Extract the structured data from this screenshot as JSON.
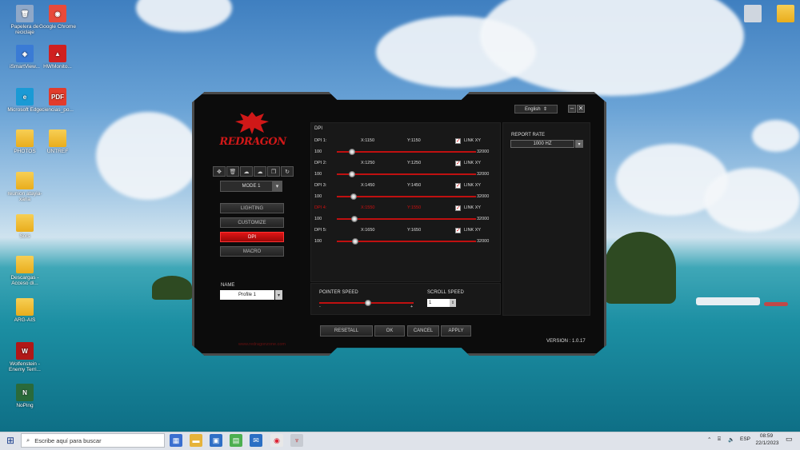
{
  "desktop": {
    "icons": [
      {
        "label": "Papelera de reciclaje",
        "glyph": "🗑",
        "color": "#8fa8c8"
      },
      {
        "label": "Google Chrome",
        "glyph": "◉",
        "color": "#e84a3a"
      },
      {
        "label": "iSmartView...",
        "glyph": "◈",
        "color": "#3a7bd5"
      },
      {
        "label": "HWMonito...",
        "glyph": "▲",
        "color": "#d02020"
      },
      {
        "label": "Microsoft Edge",
        "glyph": "e",
        "color": "#1a9ad5"
      },
      {
        "label": "ciencias_po...",
        "glyph": "PDF",
        "color": "#e23c2c"
      },
      {
        "label": "PHOTOS",
        "glyph": "",
        "color": "folder"
      },
      {
        "label": "UNTREF",
        "glyph": "",
        "color": "folder"
      },
      {
        "label": "reunion atayia-xana",
        "glyph": "",
        "color": "folder"
      },
      {
        "label": "Sors",
        "glyph": "",
        "color": "folder"
      },
      {
        "label": "Descargas - Acceso di...",
        "glyph": "",
        "color": "folder"
      },
      {
        "label": "ARG-AIS",
        "glyph": "",
        "color": "folder"
      },
      {
        "label": "Wolfenstein - Enemy Terri...",
        "glyph": "W",
        "color": "#b01818"
      },
      {
        "label": "NoPing",
        "glyph": "N",
        "color": "#2a6a3a"
      },
      {
        "label": "",
        "glyph": "",
        "color": "#cfd6df"
      },
      {
        "label": "",
        "glyph": "",
        "color": "folder"
      }
    ]
  },
  "app": {
    "brand": "REDRAGON",
    "language": "English",
    "mode": "MODE 1",
    "nav": [
      "LIGHTING",
      "CUSTOMIZE",
      "DPI",
      "MACRO"
    ],
    "active_nav": "DPI",
    "name_label": "NAME",
    "profile": "Profile 1",
    "url": "www.redragonzone.com",
    "dpi_title": "DPI",
    "dpi_rows": [
      {
        "label": "DPI 1:",
        "x": "X:1150",
        "y": "Y:1150",
        "link": "LINK XY",
        "min": "100",
        "max": "32000",
        "value": 1150,
        "active": false
      },
      {
        "label": "DPI 2:",
        "x": "X:1250",
        "y": "Y:1250",
        "link": "LINK XY",
        "min": "100",
        "max": "32000",
        "value": 1250,
        "active": false
      },
      {
        "label": "DPI 3:",
        "x": "X:1450",
        "y": "Y:1450",
        "link": "LINK XY",
        "min": "100",
        "max": "32000",
        "value": 1450,
        "active": false
      },
      {
        "label": "DPI 4:",
        "x": "X:1550",
        "y": "Y:1550",
        "link": "LINK XY",
        "min": "100",
        "max": "32000",
        "value": 1550,
        "active": true
      },
      {
        "label": "DPI 5:",
        "x": "X:1650",
        "y": "Y:1650",
        "link": "LINK XY",
        "min": "100",
        "max": "32000",
        "value": 1650,
        "active": false
      }
    ],
    "report_rate_label": "REPORT RATE",
    "report_rate": "1000 HZ",
    "pointer_speed_label": "POINTER SPEED",
    "pointer_speed_fraction": 0.52,
    "pointer_minus": "-",
    "pointer_plus": "+",
    "scroll_speed_label": "SCROLL SPEED",
    "scroll_speed": "1",
    "buttons": {
      "resetall": "RESETALL",
      "ok": "OK",
      "cancel": "CANCEL",
      "apply": "APPLY"
    },
    "version": "VERSION : 1.0.17"
  },
  "taskbar": {
    "search_placeholder": "Escribe aquí para buscar",
    "lang": "ESP",
    "time": "08:59",
    "date": "22/1/2023"
  },
  "colors": {
    "accent": "#d01010",
    "panel": "#181818"
  }
}
